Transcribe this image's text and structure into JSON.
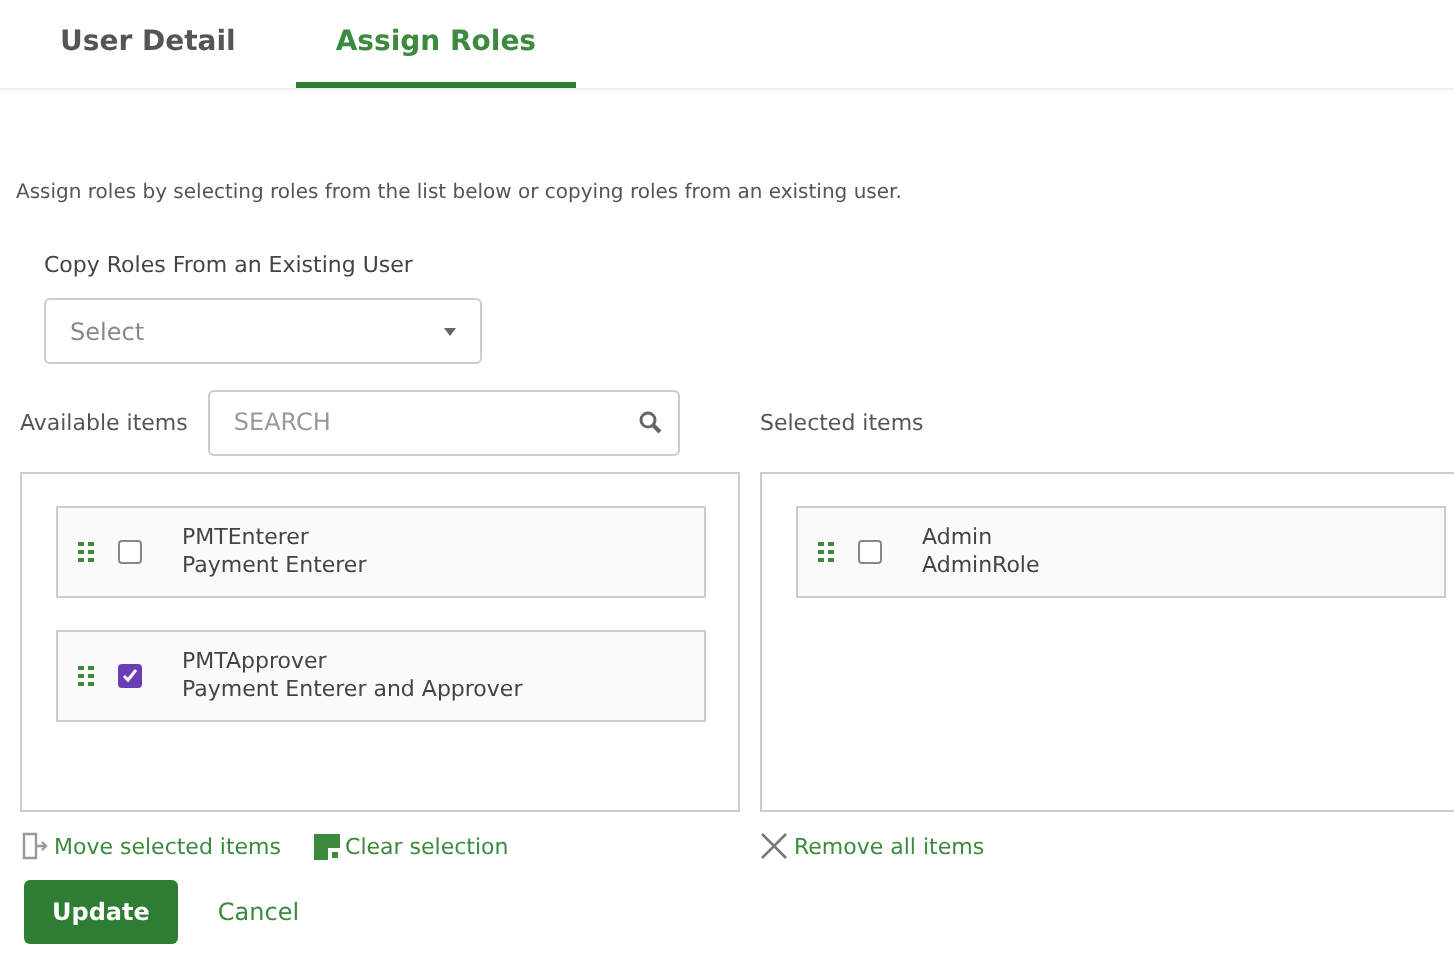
{
  "tabs": [
    {
      "label": "User Detail",
      "selected": false
    },
    {
      "label": "Assign Roles",
      "selected": true
    }
  ],
  "description": "Assign roles by selecting roles from the list below or copying roles from an existing user.",
  "copy_roles": {
    "label": "Copy Roles From an Existing User",
    "placeholder": "Select"
  },
  "available": {
    "label": "Available items",
    "search_placeholder": "SEARCH",
    "items": [
      {
        "name": "PMTEnterer",
        "description": "Payment Enterer",
        "checked": false
      },
      {
        "name": "PMTApprover",
        "description": "Payment Enterer and Approver",
        "checked": true
      }
    ]
  },
  "selected_list": {
    "label": "Selected items",
    "items": [
      {
        "name": "Admin",
        "description": "AdminRole",
        "checked": false
      }
    ]
  },
  "actions": [
    {
      "kind": "move",
      "label": "Move selected items"
    },
    {
      "kind": "clear",
      "label": "Clear selection"
    },
    {
      "kind": "remove",
      "label": "Remove all items"
    }
  ],
  "buttons": [
    {
      "kind": "primary",
      "label": "Update"
    },
    {
      "kind": "link",
      "label": "Cancel"
    }
  ]
}
